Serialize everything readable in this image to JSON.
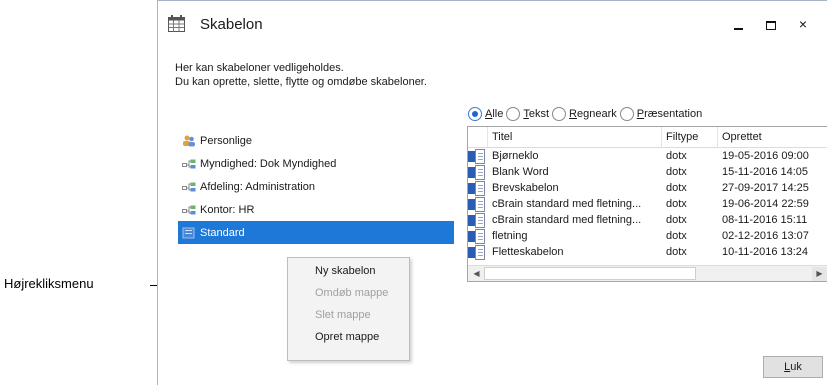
{
  "annotation": {
    "label": "Højrekliksmenu"
  },
  "window": {
    "title": "Skabelon",
    "close_glyph": "×"
  },
  "description": {
    "line1": "Her kan skabeloner vedligeholdes.",
    "line2": "Du kan oprette, slette, flytte og omdøbe skabeloner."
  },
  "filters": [
    {
      "acc": "A",
      "rest": "lle",
      "selected": true
    },
    {
      "acc": "T",
      "rest": "ekst",
      "selected": false
    },
    {
      "acc": "R",
      "rest": "egneark",
      "selected": false
    },
    {
      "acc": "P",
      "rest": "ræsentation",
      "selected": false
    }
  ],
  "tree": [
    {
      "label": "Personlige",
      "icon": "personal-folder-icon"
    },
    {
      "label": "Myndighed: Dok Myndighed",
      "icon": "org-unit-icon"
    },
    {
      "label": "Afdeling: Administration",
      "icon": "org-unit-icon"
    },
    {
      "label": "Kontor: HR",
      "icon": "org-unit-icon"
    },
    {
      "label": "Standard",
      "icon": "standard-folder-icon",
      "selected": true
    }
  ],
  "context_menu": [
    {
      "label": "Ny skabelon",
      "enabled": true
    },
    {
      "label": "Omdøb mappe",
      "enabled": false
    },
    {
      "label": "Slet mappe",
      "enabled": false
    },
    {
      "label": "Opret mappe",
      "enabled": true
    }
  ],
  "table": {
    "headers": {
      "title": "Titel",
      "type": "Filtype",
      "created": "Oprettet"
    },
    "rows": [
      {
        "title": "Bjørneklo",
        "type": "dotx",
        "created": "19-05-2016 09:00"
      },
      {
        "title": "Blank Word",
        "type": "dotx",
        "created": "15-11-2016 14:05"
      },
      {
        "title": "Brevskabelon",
        "type": "dotx",
        "created": "27-09-2017 14:25"
      },
      {
        "title": "cBrain standard med fletning...",
        "type": "dotx",
        "created": "19-06-2014 22:59"
      },
      {
        "title": "cBrain standard med fletning...",
        "type": "dotx",
        "created": "08-11-2016 15:11"
      },
      {
        "title": "fletning",
        "type": "dotx",
        "created": "02-12-2016 13:07"
      },
      {
        "title": "Fletteskabelon",
        "type": "dotx",
        "created": "10-11-2016 13:24"
      }
    ]
  },
  "buttons": {
    "close_acc": "L",
    "close_rest": "uk"
  }
}
